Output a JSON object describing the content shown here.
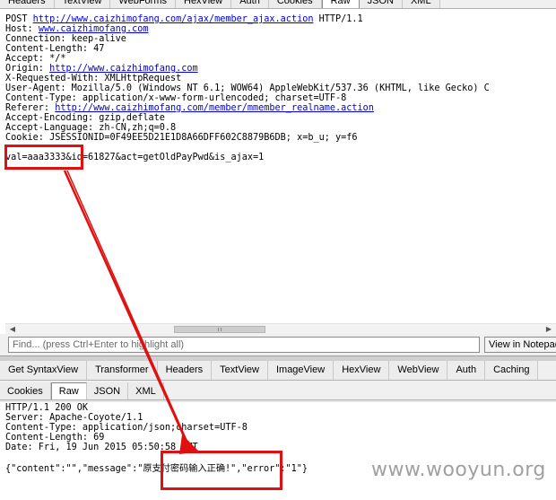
{
  "request_tabs": [
    "Headers",
    "TextView",
    "WebForms",
    "HexView",
    "Auth",
    "Cookies",
    "Raw",
    "JSON",
    "XML"
  ],
  "request_active_tab": "Raw",
  "request": {
    "lines": [
      {
        "prefix": "POST ",
        "link": "http://www.caizhimofang.com/ajax/member_ajax.action",
        "suffix": " HTTP/1.1"
      },
      {
        "prefix": "Host: ",
        "link": "www.caizhimofang.com",
        "suffix": ""
      },
      {
        "prefix": "Connection: keep-alive",
        "link": "",
        "suffix": ""
      },
      {
        "prefix": "Content-Length: 47",
        "link": "",
        "suffix": ""
      },
      {
        "prefix": "Accept: */*",
        "link": "",
        "suffix": ""
      },
      {
        "prefix": "Origin: ",
        "link": "http://www.caizhimofang.com",
        "suffix": ""
      },
      {
        "prefix": "X-Requested-With: XMLHttpRequest",
        "link": "",
        "suffix": ""
      },
      {
        "prefix": "User-Agent: Mozilla/5.0 (Windows NT 6.1; WOW64) AppleWebKit/537.36 (KHTML, like Gecko) C",
        "link": "",
        "suffix": ""
      },
      {
        "prefix": "Content-Type: application/x-www-form-urlencoded; charset=UTF-8",
        "link": "",
        "suffix": ""
      },
      {
        "prefix": "Referer: ",
        "link": "http://www.caizhimofang.com/member/mmember_realname.action",
        "suffix": ""
      },
      {
        "prefix": "Accept-Encoding: gzip,deflate",
        "link": "",
        "suffix": ""
      },
      {
        "prefix": "Accept-Language: zh-CN,zh;q=0.8",
        "link": "",
        "suffix": ""
      },
      {
        "prefix": "Cookie: JSESSIONID=0F49EE5D21E1D8A66DFF602C8879B6DB; x=b_u; y=f6",
        "link": "",
        "suffix": ""
      },
      {
        "prefix": "",
        "link": "",
        "suffix": ""
      },
      {
        "prefix": "val=aaa3333&id=61827&act=getOldPayPwd&is_ajax=1",
        "link": "",
        "suffix": ""
      }
    ]
  },
  "find": {
    "placeholder": "Find... (press Ctrl+Enter to highlight all)",
    "notepad_label": "View in Notepad"
  },
  "inspector_tabs": [
    "Get SyntaxView",
    "Transformer",
    "Headers",
    "TextView",
    "ImageView",
    "HexView",
    "WebView",
    "Auth",
    "Caching"
  ],
  "response_tabs": [
    "Cookies",
    "Raw",
    "JSON",
    "XML"
  ],
  "response_active_tab": "Raw",
  "response": {
    "lines": [
      "HTTP/1.1 200 OK",
      "Server: Apache-Coyote/1.1",
      "Content-Type: application/json;charset=UTF-8",
      "Content-Length: 69",
      "Date: Fri, 19 Jun 2015 05:50:58 GMT",
      "",
      "{\"content\":\"\",\"message\":\"原支付密码输入正确!\",\"error\":\"1\"}"
    ]
  },
  "watermark": "www.wooyun.org",
  "annotation_color": "#e01010"
}
